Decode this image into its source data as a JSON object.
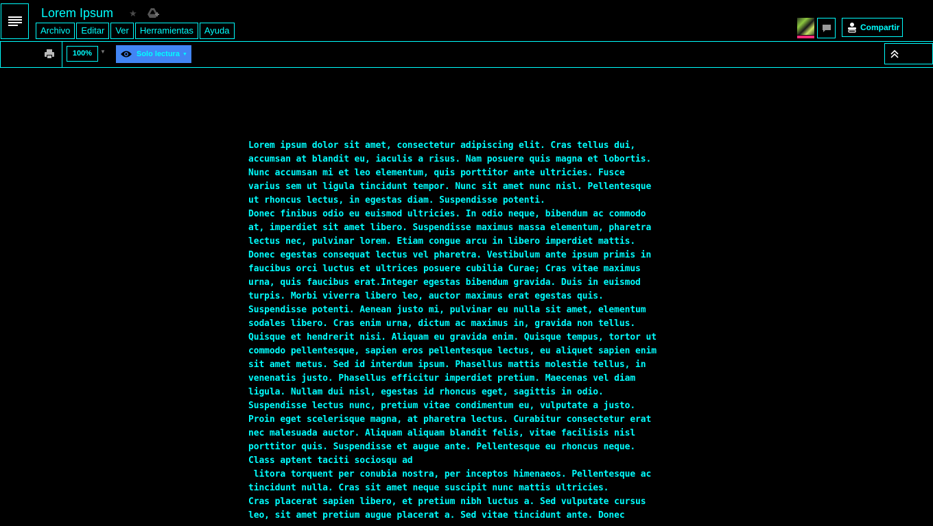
{
  "header": {
    "title": "Lorem Ipsum",
    "menus": [
      "Archivo",
      "Editar",
      "Ver",
      "Herramientas",
      "Ayuda"
    ],
    "share_label": "Compartir"
  },
  "toolbar": {
    "zoom": "100%",
    "mode_label": "Solo lectura"
  },
  "icons": {
    "menu": "hamburger-icon",
    "star": "star-icon",
    "drive": "add-to-drive-icon",
    "comment": "comment-icon",
    "share": "person-icon",
    "print": "print-icon",
    "eye": "eye-icon",
    "collapse": "double-chevron-up-icon"
  },
  "colors": {
    "accent": "#00ffff",
    "background": "#000000",
    "mode_button": "#4285f4",
    "avatar_bar": "#ff2c7a"
  },
  "document": {
    "lines": [
      "Lorem ipsum dolor sit amet, consectetur adipiscing elit. Cras tellus dui,",
      "accumsan at blandit eu, iaculis a risus. Nam posuere quis magna et lobortis.",
      "Nunc accumsan mi et leo elementum, quis porttitor ante ultricies. Fusce",
      "varius sem ut ligula tincidunt tempor. Nunc sit amet nunc nisl. Pellentesque",
      "ut rhoncus lectus, in egestas diam. Suspendisse potenti.",
      "Donec finibus odio eu euismod ultricies. In odio neque, bibendum ac commodo",
      "at, imperdiet sit amet libero. Suspendisse maximus massa elementum, pharetra",
      "lectus nec, pulvinar lorem. Etiam congue arcu in libero imperdiet mattis.",
      "Donec egestas consequat lectus vel pharetra. Vestibulum ante ipsum primis in",
      "faucibus orci luctus et ultrices posuere cubilia Curae; Cras vitae maximus",
      "urna, quis faucibus erat.Integer egestas bibendum gravida. Duis in euismod",
      "turpis. Morbi viverra libero leo, auctor maximus erat egestas quis.",
      "Suspendisse potenti. Aenean justo mi, pulvinar eu nulla sit amet, elementum",
      "sodales libero. Cras enim urna, dictum ac maximus in, gravida non tellus.",
      "Quisque et hendrerit nisi. Aliquam eu gravida enim. Quisque tempus, tortor ut",
      "commodo pellentesque, sapien eros pellentesque lectus, eu aliquet sapien enim",
      "sit amet metus. Sed id interdum ipsum. Phasellus mattis molestie tellus, in",
      "venenatis justo. Phasellus efficitur imperdiet pretium. Maecenas vel diam",
      "ligula. Nullam dui nisl, egestas id rhoncus eget, sagittis in odio.",
      "Suspendisse lectus nunc, pretium vitae condimentum eu, vulputate a justo.",
      "Proin eget scelerisque magna, at pharetra lectus. Curabitur consectetur erat",
      "nec malesuada auctor. Aliquam aliquam blandit felis, vitae facilisis nisl",
      "porttitor quis. Suspendisse et augue ante. Pellentesque eu rhoncus neque.",
      "Class aptent taciti sociosqu ad",
      " litora torquent per conubia nostra, per inceptos himenaeos. Pellentesque ac",
      "tincidunt nulla. Cras sit amet neque suscipit nunc mattis ultricies.",
      "Cras placerat sapien libero, et pretium nibh luctus a. Sed vulputate cursus",
      "leo, sit amet pretium augue placerat a. Sed vitae tincidunt ante. Donec"
    ]
  }
}
